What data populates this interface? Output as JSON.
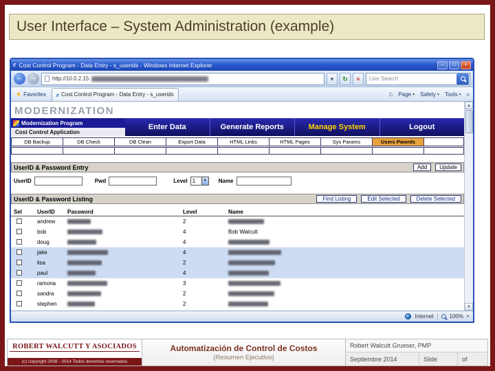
{
  "slide": {
    "title": "User Interface – System Administration (example)"
  },
  "colors": {
    "slide_border": "#7b1618",
    "title_banner_bg": "#ece7c4",
    "nav_bg": "#1c1c96",
    "nav_highlight": "#ffd400",
    "subnav_highlight_bg": "#e8a23c",
    "row_band_bg": "#cddcf2",
    "footer_accent": "#7b1618"
  },
  "browser": {
    "window_title": "Cost Control Program - Data Entry - s_userids - Windows Internet Explorer",
    "url_prefix": "http://10.0.2.15",
    "search_placeholder": "Live Search",
    "favorites_label": "Favorites",
    "tab_title": "Cost Control Program - Data Entry - s_userids",
    "menu_items": [
      "Page",
      "Safety",
      "Tools"
    ],
    "overflow_chevron": "»",
    "status_zone": "Internet",
    "zoom_level": "100%"
  },
  "app": {
    "logo_text": "MODERNIZATION",
    "program_title": "Modernization Program",
    "app_title": "Cost Control Application",
    "nav_items": [
      {
        "label": "Enter Data",
        "active": false
      },
      {
        "label": "Generate Reports",
        "active": false
      },
      {
        "label": "Manage System",
        "active": true
      },
      {
        "label": "Logout",
        "active": false
      }
    ],
    "subnav_items": [
      {
        "label": "DB Backup",
        "active": false
      },
      {
        "label": "DB Check",
        "active": false
      },
      {
        "label": "DB Clean",
        "active": false
      },
      {
        "label": "Export Data",
        "active": false
      },
      {
        "label": "HTML Links",
        "active": false
      },
      {
        "label": "HTML Pages",
        "active": false
      },
      {
        "label": "Sys Params",
        "active": false
      },
      {
        "label": "Users Pwords",
        "active": true
      }
    ],
    "entry": {
      "title": "UserID & Password Entry",
      "add_button": "Add",
      "update_button": "Update",
      "userid_label": "UserID",
      "pwd_label": "Pwd",
      "level_label": "Level",
      "level_value": "1",
      "name_label": "Name"
    },
    "listing": {
      "title": "UserID & Password Listing",
      "find_button": "Find Listing",
      "edit_button": "Edit Selected",
      "delete_button": "Delete Selected",
      "columns": [
        "Sel",
        "UserID",
        "Password",
        "Level",
        "Name"
      ],
      "rows": [
        {
          "userid": "andrew",
          "password": "",
          "level": "2",
          "name": ""
        },
        {
          "userid": "bob",
          "password": "",
          "level": "4",
          "name": "Bob Walcutt"
        },
        {
          "userid": "doug",
          "password": "",
          "level": "4",
          "name": ""
        },
        {
          "userid": "jake",
          "password": "",
          "level": "4",
          "name": ""
        },
        {
          "userid": "lisa",
          "password": "",
          "level": "2",
          "name": ""
        },
        {
          "userid": "paul",
          "password": "",
          "level": "4",
          "name": ""
        },
        {
          "userid": "ramona",
          "password": "",
          "level": "3",
          "name": ""
        },
        {
          "userid": "sandra",
          "password": "",
          "level": "2",
          "name": ""
        },
        {
          "userid": "stephen",
          "password": "",
          "level": "2",
          "name": ""
        }
      ]
    }
  },
  "footer": {
    "company": "ROBERT WALCUTT Y ASOCIADOS",
    "copyright": "(c) copyright 2008 - 2014 Todos derechos reservados",
    "title": "Automatización de Control de Costos",
    "subtitle": "(Resumen Ejecutivo)",
    "author": "Robert Walcutt Grueser, PMP",
    "date": "Septiembre 2014",
    "slide_label": "Slide",
    "of_label": "of"
  }
}
